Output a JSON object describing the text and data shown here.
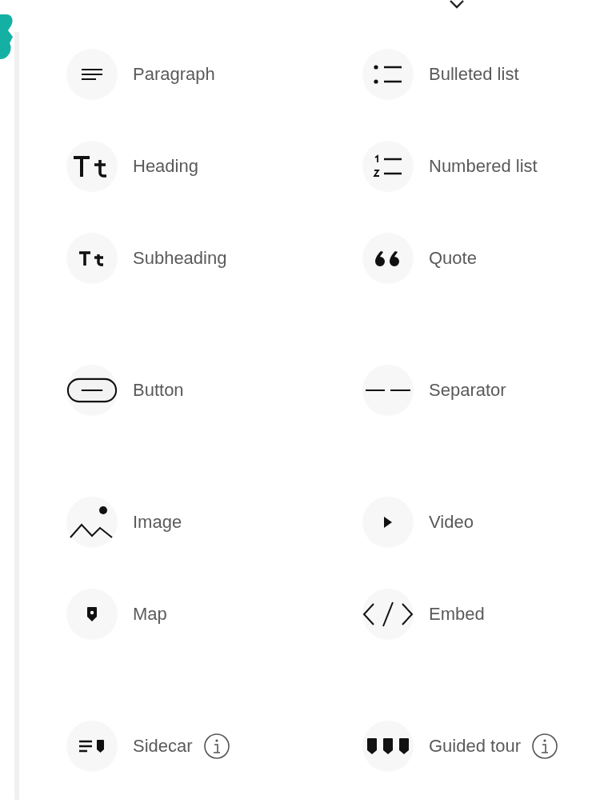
{
  "groups": [
    {
      "items": [
        {
          "kind": "paragraph",
          "label": "Paragraph",
          "info": false
        },
        {
          "kind": "bulleted",
          "label": "Bulleted list",
          "info": false
        },
        {
          "kind": "heading",
          "label": "Heading",
          "info": false
        },
        {
          "kind": "numbered",
          "label": "Numbered list",
          "info": false
        },
        {
          "kind": "subheading",
          "label": "Subheading",
          "info": false
        },
        {
          "kind": "quote",
          "label": "Quote",
          "info": false
        }
      ]
    },
    {
      "items": [
        {
          "kind": "button",
          "label": "Button",
          "info": false
        },
        {
          "kind": "separator",
          "label": "Separator",
          "info": false
        }
      ]
    },
    {
      "items": [
        {
          "kind": "image",
          "label": "Image",
          "info": false
        },
        {
          "kind": "video",
          "label": "Video",
          "info": false
        },
        {
          "kind": "map",
          "label": "Map",
          "info": false
        },
        {
          "kind": "embed",
          "label": "Embed",
          "info": false
        }
      ]
    },
    {
      "items": [
        {
          "kind": "sidecar",
          "label": "Sidecar",
          "info": true
        },
        {
          "kind": "tour",
          "label": "Guided tour",
          "info": true
        }
      ]
    }
  ]
}
